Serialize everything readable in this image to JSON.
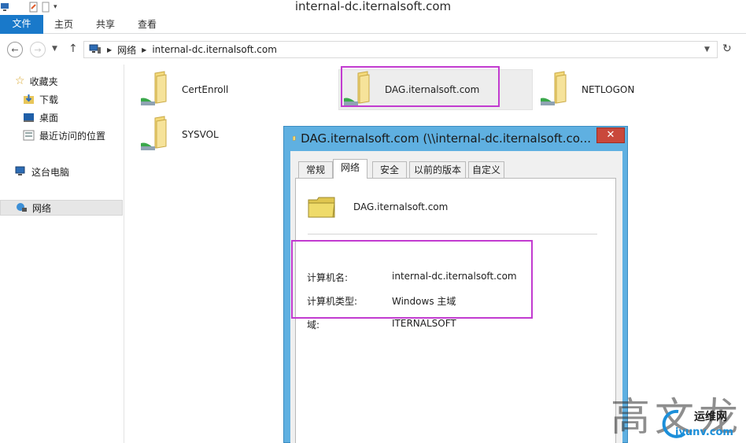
{
  "window": {
    "title": "internal-dc.iternalsoft.com"
  },
  "ribbon": {
    "tabs": [
      "文件",
      "主页",
      "共享",
      "查看"
    ]
  },
  "address": {
    "segments": [
      "网络",
      "internal-dc.iternalsoft.com"
    ]
  },
  "nav": {
    "favorites": "收藏夹",
    "downloads": "下载",
    "desktop": "桌面",
    "recent": "最近访问的位置",
    "this_pc": "这台电脑",
    "network": "网络"
  },
  "folders": [
    {
      "name": "CertEnroll"
    },
    {
      "name": "DAG.iternalsoft.com"
    },
    {
      "name": "NETLOGON"
    },
    {
      "name": "SYSVOL"
    }
  ],
  "dialog": {
    "title": "DAG.iternalsoft.com (\\\\internal-dc.iternalsoft.co...",
    "close": "✕",
    "tabs": [
      "常规",
      "网络",
      "安全",
      "以前的版本",
      "自定义"
    ],
    "active_tab": "网络",
    "share_name": "DAG.iternalsoft.com",
    "props": [
      {
        "label": "计算机名:",
        "value": "internal-dc.iternalsoft.com"
      },
      {
        "label": "计算机类型:",
        "value": "Windows 主域"
      },
      {
        "label": "域:",
        "value": "ITERNALSOFT"
      }
    ]
  },
  "watermark": {
    "chars": "高文龙",
    "logo_text": "运维网",
    "logo_url": "iyunv.com"
  },
  "colors": {
    "file_tab": "#1979ca",
    "dialog_frame": "#5fb0e1",
    "close_button": "#c9483b",
    "highlight_box": "#c23bd0",
    "folder_yellow": "#f1d672"
  }
}
